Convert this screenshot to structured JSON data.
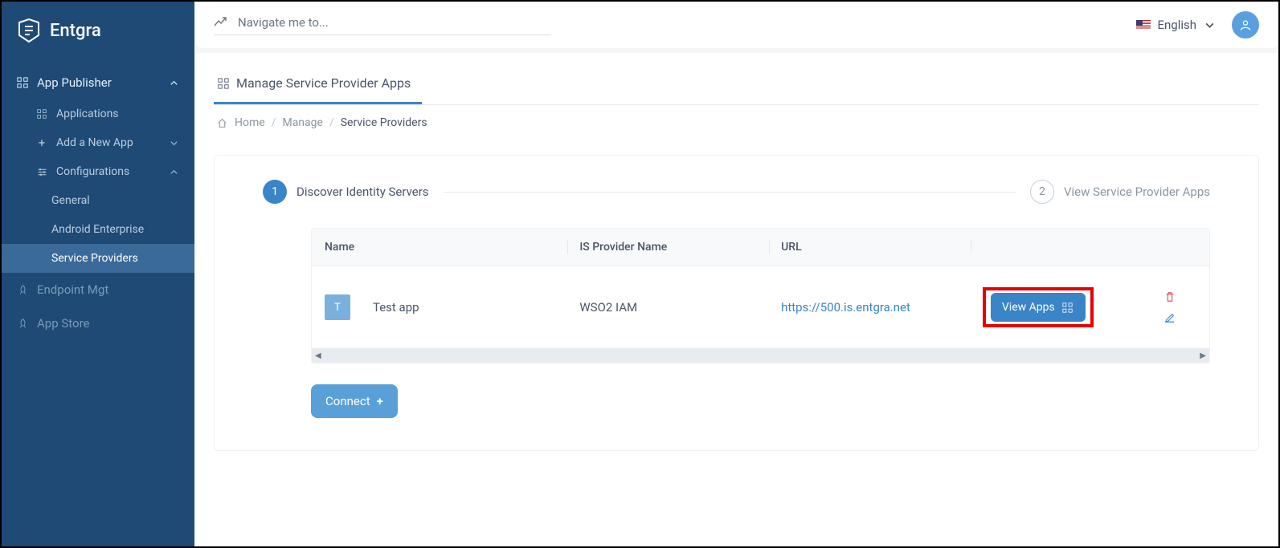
{
  "brand": "Entgra",
  "topbar": {
    "navigate_placeholder": "Navigate me to...",
    "language": "English"
  },
  "sidebar": {
    "section_publisher": "App Publisher",
    "items": {
      "applications": "Applications",
      "add_new": "Add a New App",
      "configurations": "Configurations"
    },
    "subs": {
      "general": "General",
      "android_enterprise": "Android Enterprise",
      "service_providers": "Service Providers"
    },
    "endpoint": "Endpoint Mgt",
    "appstore": "App Store"
  },
  "page": {
    "tab_label": "Manage Service Provider Apps",
    "breadcrumb": {
      "home": "Home",
      "manage": "Manage",
      "current": "Service Providers"
    }
  },
  "steps": {
    "one_num": "1",
    "one_label": "Discover Identity Servers",
    "two_num": "2",
    "two_label": "View Service Provider Apps"
  },
  "table": {
    "headers": {
      "name": "Name",
      "provider": "IS Provider Name",
      "url": "URL"
    },
    "row": {
      "badge": "T",
      "name": "Test app",
      "provider": "WSO2 IAM",
      "url": "https://500.is.entgra.net",
      "view_label": "View Apps"
    }
  },
  "connect_label": "Connect"
}
